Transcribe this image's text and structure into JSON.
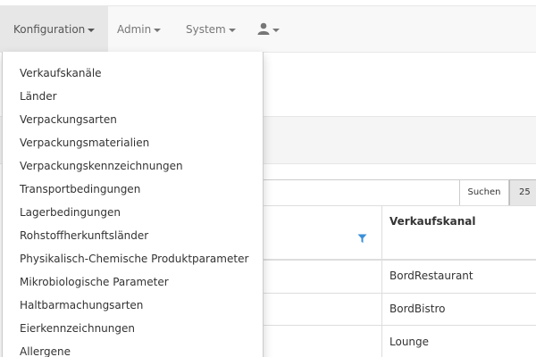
{
  "navbar": {
    "items": [
      {
        "label": "Konfiguration"
      },
      {
        "label": "Admin"
      },
      {
        "label": "System"
      }
    ]
  },
  "dropdown": {
    "items": [
      {
        "label": "Verkaufskanäle"
      },
      {
        "label": "Länder"
      },
      {
        "label": "Verpackungsarten"
      },
      {
        "label": "Verpackungsmaterialien"
      },
      {
        "label": "Verpackungskennzeichnungen"
      },
      {
        "label": "Transportbedingungen"
      },
      {
        "label": "Lagerbedingungen"
      },
      {
        "label": "Rohstoffherkunftsländer"
      },
      {
        "label": "Physikalisch-Chemische Produktparameter"
      },
      {
        "label": "Mikrobiologische Parameter"
      },
      {
        "label": "Haltbarmachungsarten"
      },
      {
        "label": "Eierkennzeichnungen"
      },
      {
        "label": "Allergene"
      }
    ]
  },
  "search": {
    "button_label": "Suchen",
    "page_size": "25"
  },
  "table": {
    "column_header": "Verkaufskanal",
    "rows": [
      {
        "value": "BordRestaurant"
      },
      {
        "value": "BordBistro"
      },
      {
        "value": "Lounge"
      }
    ]
  }
}
